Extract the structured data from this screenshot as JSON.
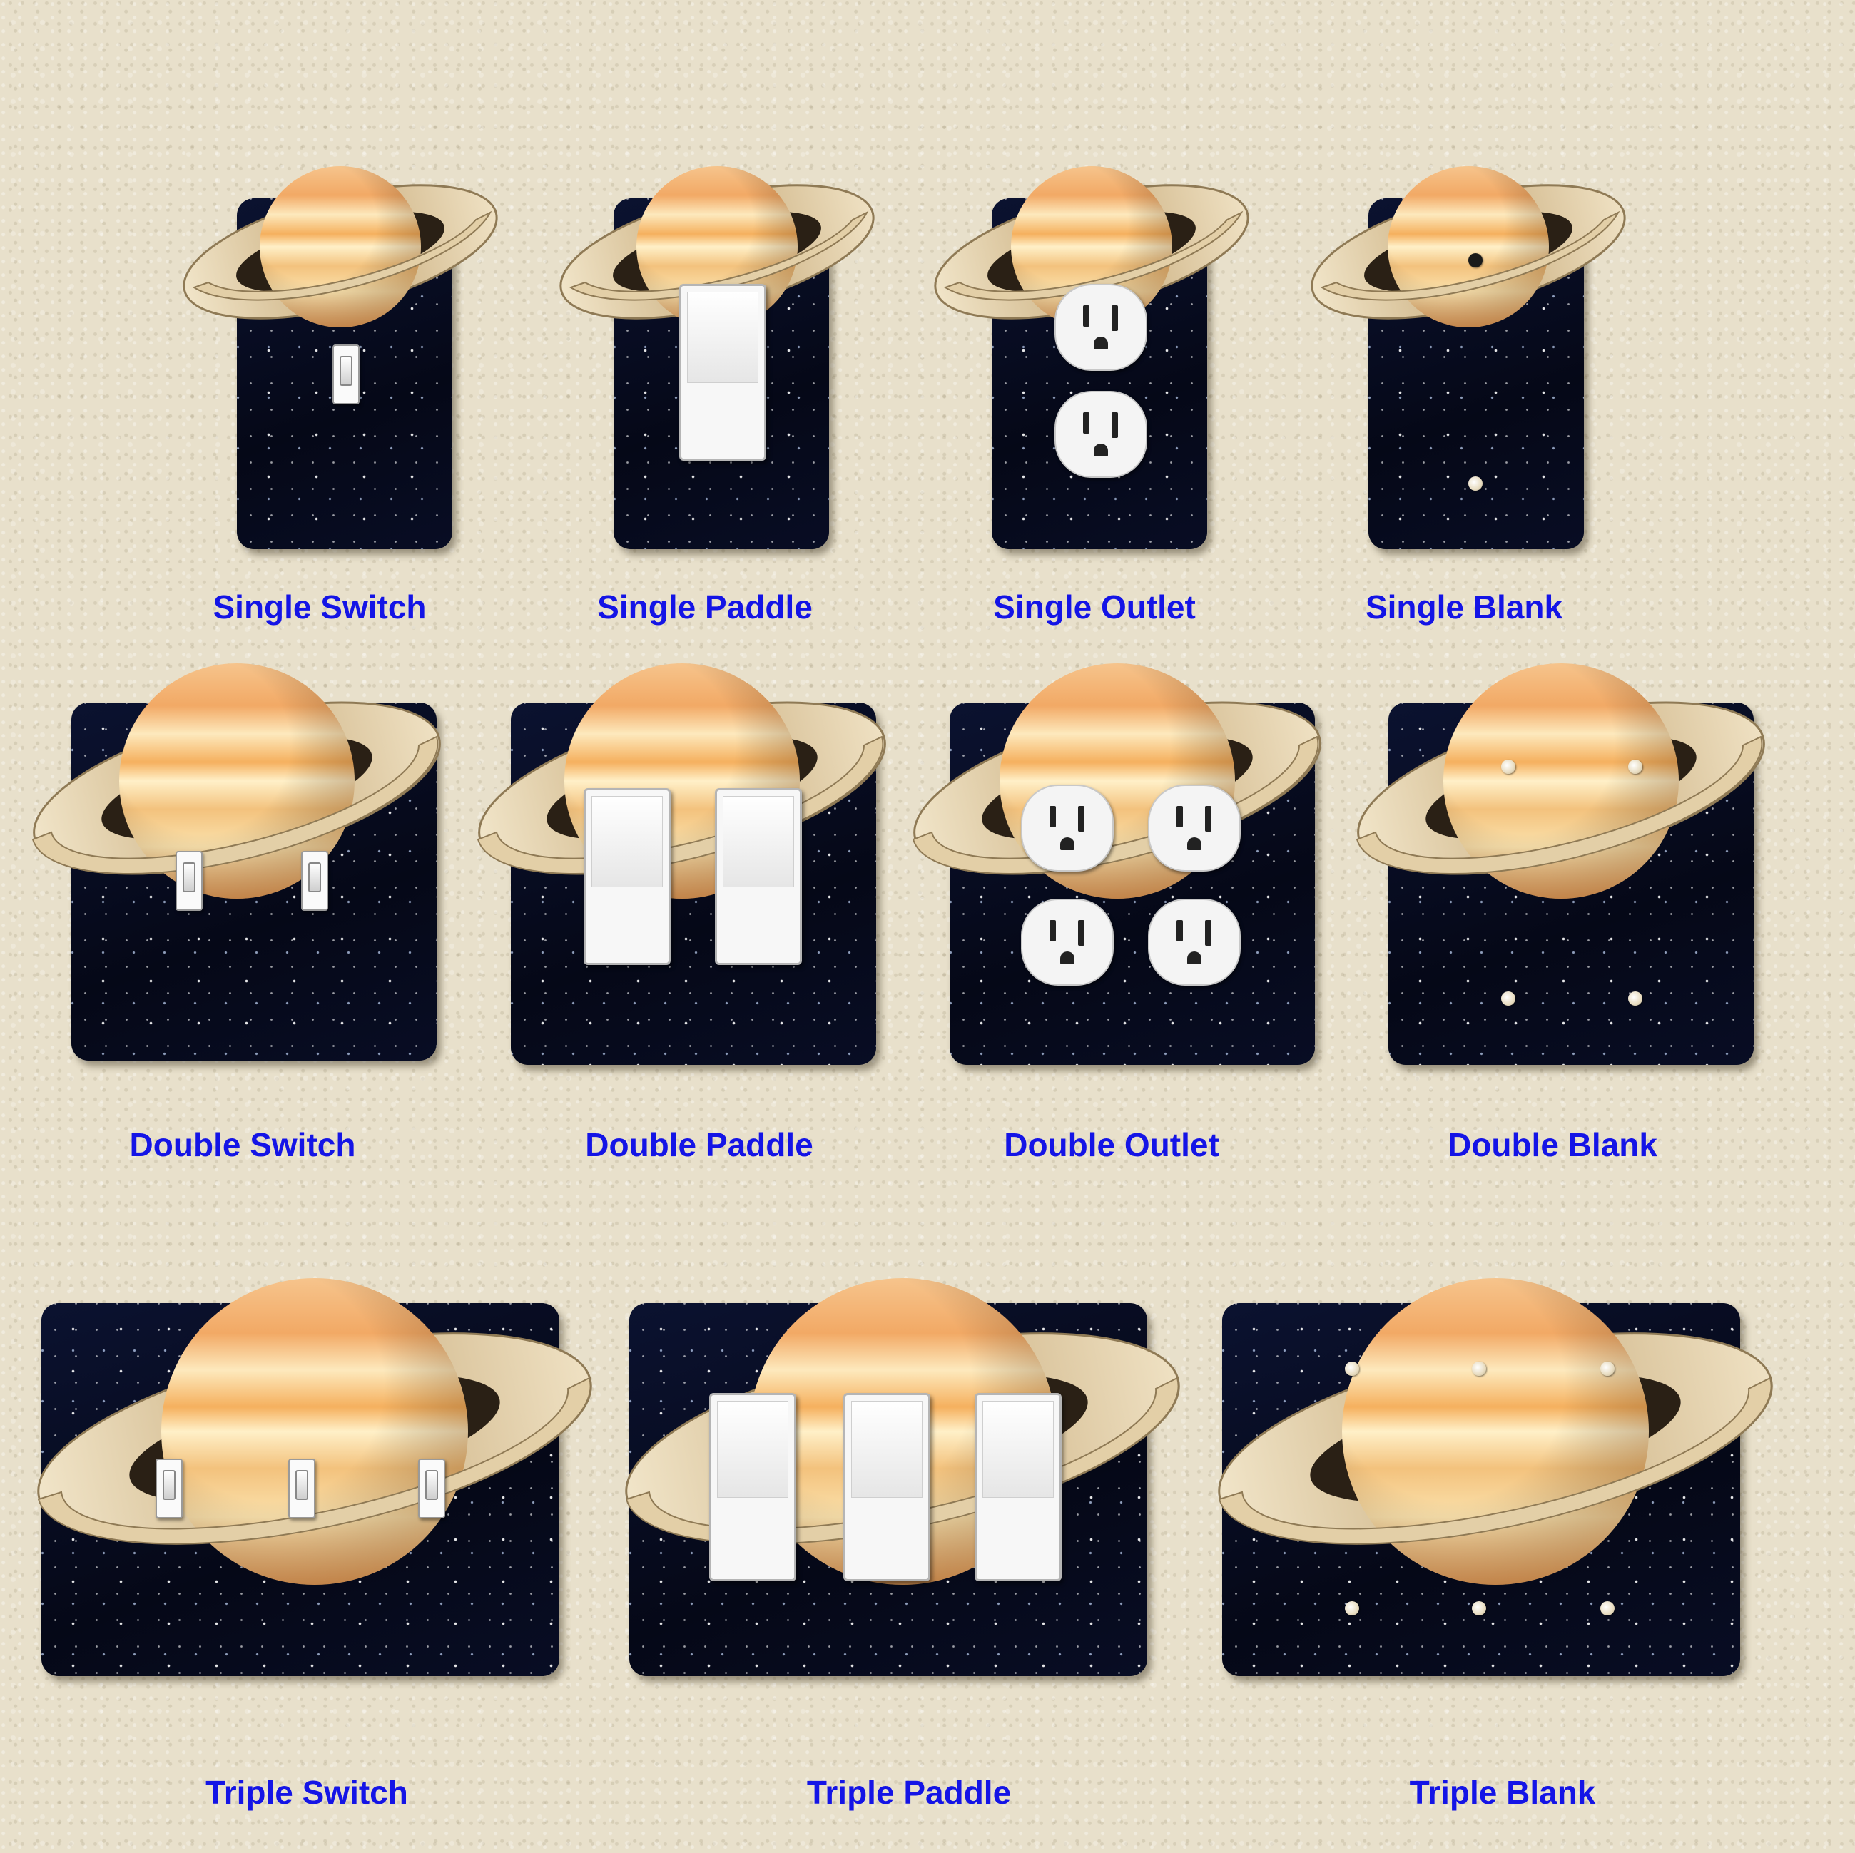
{
  "labels": {
    "single_switch": "Single Switch",
    "single_paddle": "Single Paddle",
    "single_outlet": "Single Outlet",
    "single_blank": "Single Blank",
    "double_switch": "Double Switch",
    "double_paddle": "Double Paddle",
    "double_outlet": "Double Outlet",
    "double_blank": "Double Blank",
    "triple_switch": "Triple Switch",
    "triple_paddle": "Triple Paddle",
    "triple_blank": "Triple Blank"
  },
  "colors": {
    "label_text": "#1414e6",
    "wall": "#e8e0cb",
    "plate_background": "#070b1e",
    "planet_band": "#f0a450",
    "planet_light": "#fbe7b6",
    "ring": "#d8c39c"
  },
  "icons": {
    "planet": "saturn-icon",
    "stars": "starfield-background"
  }
}
